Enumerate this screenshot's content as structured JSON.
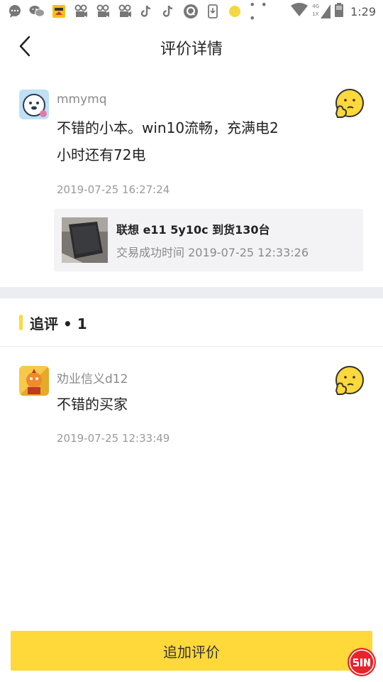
{
  "status_bar": {
    "time": "1:29",
    "network_label_top": "4G",
    "network_label_bottom": "1X",
    "icons": [
      "message-icon",
      "wechat-icon",
      "app-icon",
      "video-icon",
      "video-icon",
      "video-icon",
      "tiktok-icon",
      "tiktok-icon",
      "q-icon",
      "download-icon",
      "dot-icon",
      "more-icon",
      "wifi-icon",
      "signal-icon",
      "battery-icon"
    ]
  },
  "header": {
    "title": "评价详情"
  },
  "review": {
    "username": "mmymq",
    "text_line1": "不错的小本。win10流畅，充满电2",
    "text_line2": "小时还有72电",
    "timestamp": "2019-07-25 16:27:24",
    "rating_icon": "thinking-face-icon",
    "product": {
      "title": "联想 e11 5y10c 到货130台",
      "subtitle": "交易成功时间 2019-07-25 12:33:26"
    }
  },
  "followup": {
    "header": "追评 • 1",
    "username": "劝业信义d12",
    "text": "不错的买家",
    "timestamp": "2019-07-25 12:33:49",
    "rating_icon": "thinking-face-icon"
  },
  "bottom": {
    "button_label": "追加评价"
  },
  "colors": {
    "accent": "#ffd83a",
    "band": "#ebedf1",
    "card": "#f3f3f5"
  }
}
